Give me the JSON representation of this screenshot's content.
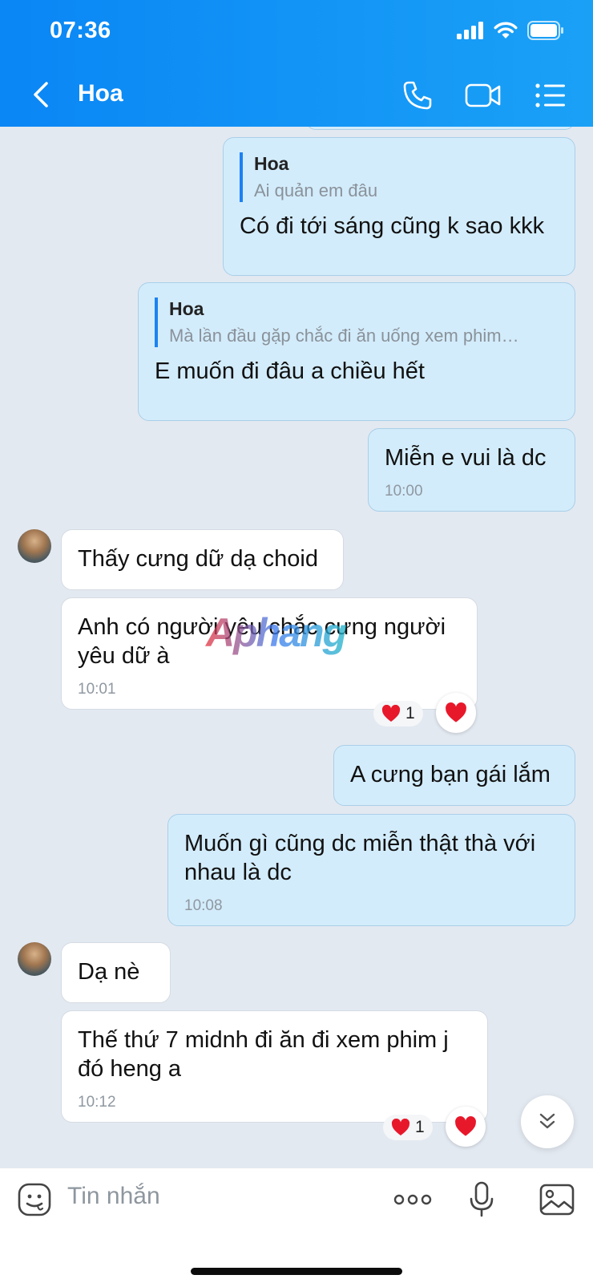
{
  "status": {
    "time": "07:36"
  },
  "header": {
    "contact_name": "Hoa"
  },
  "messages": [
    {
      "quote_name": "Hoa",
      "quote_text": "Ai quản em đâu",
      "text": "Có đi tới sáng cũng k sao kkk"
    },
    {
      "quote_name": "Hoa",
      "quote_text": "Mà lần đầu gặp chắc đi ăn uống xem phim…",
      "text": "E muốn đi đâu a chiều hết"
    },
    {
      "text": "Miễn e vui là dc",
      "time": "10:00"
    },
    {
      "text": "Thấy cưng dữ dạ choid"
    },
    {
      "text": "Anh có người yêu chắc cưng người yêu dữ à",
      "time": "10:01",
      "reaction_count": "1"
    },
    {
      "text": "A cưng bạn gái lắm"
    },
    {
      "text": "Muốn gì cũng dc miễn thật thà với nhau là dc",
      "time": "10:08"
    },
    {
      "text": "Dạ nè"
    },
    {
      "text": "Thế thứ 7 midnh đi ăn đi xem phim j đó heng a",
      "time": "10:12",
      "reaction_count": "1"
    }
  ],
  "watermark": "Aphang",
  "input": {
    "placeholder": "Tin nhắn"
  },
  "colors": {
    "header_start": "#0a86f5",
    "header_end": "#1aa1f6",
    "outgoing_bubble": "#d3ecfb",
    "incoming_bubble": "#ffffff",
    "chat_background": "#e3e9f1",
    "heart": "#e8182b"
  },
  "icons": [
    "back-chevron-icon",
    "phone-icon",
    "video-call-icon",
    "menu-list-icon",
    "sticker-icon",
    "more-dots-icon",
    "microphone-icon",
    "image-icon",
    "heart-icon",
    "double-chevron-down-icon"
  ]
}
